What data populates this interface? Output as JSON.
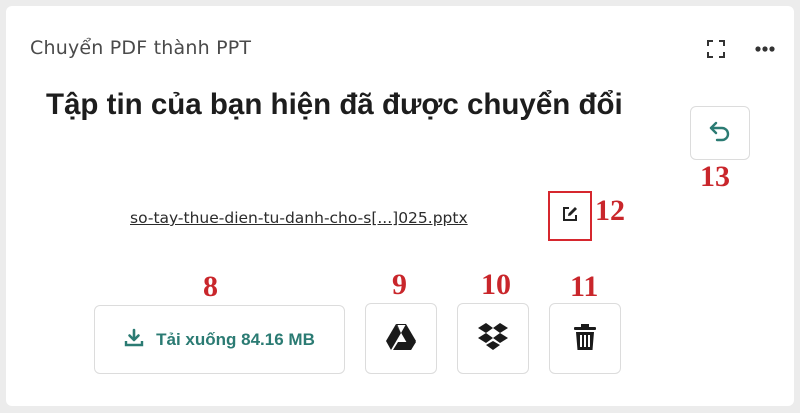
{
  "card": {
    "title": "Chuyển PDF thành PPT"
  },
  "main": {
    "heading": "Tập tin của bạn hiện đã được chuyển đổi",
    "file_name": "so-tay-thue-dien-tu-danh-cho-s[...]025.pptx"
  },
  "actions": {
    "download_label": "Tải xuống 84.16 MB"
  },
  "annotations": {
    "download": "8",
    "gdrive": "9",
    "dropbox": "10",
    "delete": "11",
    "edit": "12",
    "undo": "13"
  },
  "colors": {
    "accent": "#2b7b73",
    "annotation": "#c9262b",
    "heading": "#1d1d1d"
  },
  "icons": {
    "expand": "expand-icon",
    "more": "more-icon",
    "undo": "undo-icon",
    "edit": "edit-icon",
    "download": "download-icon",
    "gdrive": "google-drive-icon",
    "dropbox": "dropbox-icon",
    "delete": "trash-icon"
  }
}
